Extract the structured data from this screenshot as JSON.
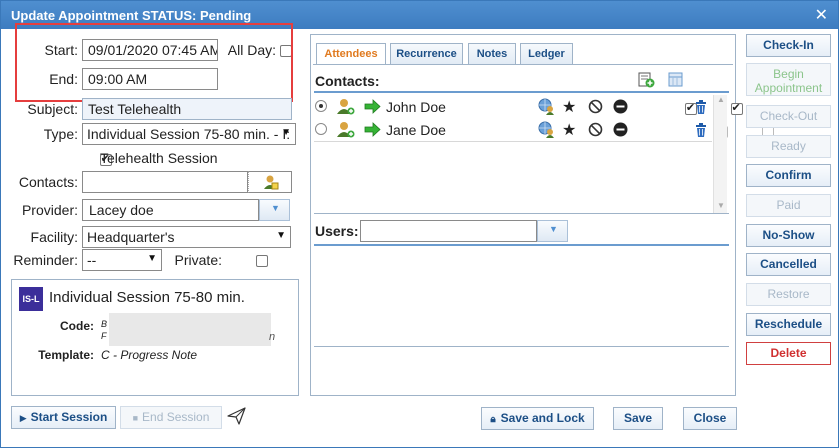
{
  "window": {
    "title": "Update Appointment STATUS: Pending",
    "close_glyph": "✕"
  },
  "form": {
    "start_label": "Start:",
    "start_value": "09/01/2020 07:45 AM",
    "allday_label": "All Day:",
    "end_label": "End:",
    "end_value": "09:00 AM",
    "subject_label": "Subject:",
    "subject_value": "Test Telehealth",
    "type_label": "Type:",
    "type_value": "Individual Session 75-80 min. - I:",
    "telehealth_label": "Telehealth Session",
    "telehealth_checked": true,
    "contacts_label": "Contacts:",
    "contacts_value": "",
    "provider_label": "Provider:",
    "provider_value": "Lacey doe",
    "facility_label": "Facility:",
    "facility_value": "Headquarter's",
    "reminder_label": "Reminder:",
    "reminder_value": "--",
    "private_label": "Private:"
  },
  "session_card": {
    "badge": "IS-L",
    "title": "Individual Session 75-80 min.",
    "code_label": "Code:",
    "code_value_line1": "B",
    "code_value_line2": "F",
    "code_value_tail": "n",
    "template_label": "Template:",
    "template_value": "C - Progress Note"
  },
  "tabs": [
    {
      "label": "Attendees",
      "active": true
    },
    {
      "label": "Recurrence",
      "active": false
    },
    {
      "label": "Notes",
      "active": false
    },
    {
      "label": "Ledger",
      "active": false
    }
  ],
  "attendees": {
    "contacts_header": "Contacts:",
    "rows": [
      {
        "name": "John Doe",
        "selected": true,
        "check1": true,
        "check2": true
      },
      {
        "name": "Jane Doe",
        "selected": false,
        "check1": false,
        "check2": false
      }
    ],
    "users_label": "Users:",
    "users_value": ""
  },
  "side_buttons": [
    {
      "label": "Check-In",
      "state": "enabled"
    },
    {
      "label": "Begin Appointment",
      "state": "green"
    },
    {
      "label": "Check-Out",
      "state": "disabled"
    },
    {
      "label": "Ready",
      "state": "disabled"
    },
    {
      "label": "Confirm",
      "state": "enabled"
    },
    {
      "label": "Paid",
      "state": "disabled"
    },
    {
      "label": "No-Show",
      "state": "enabled"
    },
    {
      "label": "Cancelled",
      "state": "enabled"
    },
    {
      "label": "Restore",
      "state": "disabled"
    },
    {
      "label": "Reschedule",
      "state": "enabled"
    },
    {
      "label": "Delete",
      "state": "delete"
    }
  ],
  "bottom": {
    "start_session": "Start Session",
    "end_session": "End Session",
    "save_and_lock": "Save and Lock",
    "save": "Save",
    "close": "Close"
  },
  "colors": {
    "titlebar": "#3d7cc0",
    "accent_orange": "#e07a1f",
    "button_text": "#1c4f86",
    "delete_red": "#d03030",
    "highlight_red": "#e53e3e",
    "badge_purple": "#3b2e9a"
  }
}
